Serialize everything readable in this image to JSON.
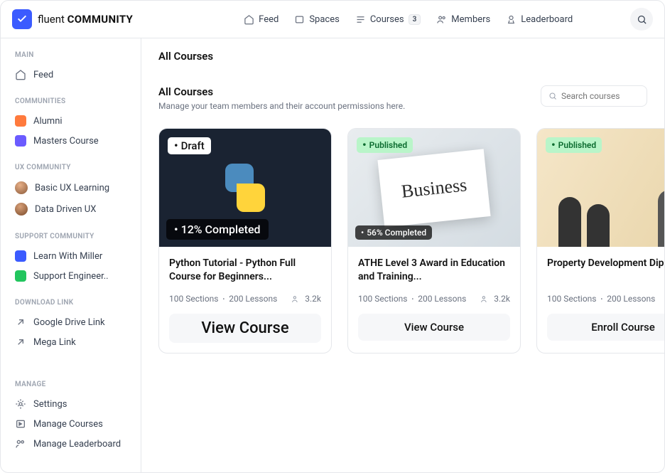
{
  "logo": {
    "text1": "fluent",
    "text2": "COMMUNITY"
  },
  "topnav": {
    "feed": "Feed",
    "spaces": "Spaces",
    "courses": "Courses",
    "courses_badge": "3",
    "members": "Members",
    "leaderboard": "Leaderboard"
  },
  "sidebar": {
    "labels": {
      "main": "MAIN",
      "communities": "COMMUNITIES",
      "ux": "UX COMMUNITY",
      "support": "SUPPORT COMMUNITY",
      "download": "DOWNLOAD LINK",
      "manage": "MANAGE"
    },
    "main": {
      "feed": "Feed"
    },
    "communities": {
      "alumni": "Alumni",
      "masters": "Masters Course"
    },
    "ux": {
      "basic": "Basic UX Learning",
      "data": "Data Driven UX"
    },
    "support": {
      "miller": "Learn With Miller",
      "eng": "Support Engineer.."
    },
    "download": {
      "gdrive": "Google Drive Link",
      "mega": "Mega Link"
    },
    "manage": {
      "settings": "Settings",
      "courses": "Manage Courses",
      "leaderboard": "Manage Leaderboard"
    }
  },
  "page": {
    "breadcrumb": "All Courses",
    "title": "All Courses",
    "subtitle": "Manage your team members and their account permissions here.",
    "search_placeholder": "Search courses"
  },
  "courses": [
    {
      "status": "Draft",
      "status_class": "",
      "progress": "12% Completed",
      "progress_class": "",
      "title": "Python Tutorial - Python Full Course for Beginners...",
      "sections": "100 Sections",
      "lessons": "200 Lessons",
      "members": "3.2k",
      "button": "View Course",
      "button_class": "big",
      "thumb_text": ""
    },
    {
      "status": "Published",
      "status_class": "pub",
      "progress": "56% Completed",
      "progress_class": "sm",
      "title": "ATHE Level 3 Award in Education and Training...",
      "sections": "100 Sections",
      "lessons": "200 Lessons",
      "members": "3.2k",
      "button": "View Course",
      "button_class": "",
      "thumb_text": "Business"
    },
    {
      "status": "Published",
      "status_class": "pub",
      "progress": "",
      "progress_class": "",
      "title": "Property Development Dip",
      "sections": "100 Sections",
      "lessons": "200 Lessons",
      "members": "",
      "button": "Enroll Course",
      "button_class": "",
      "thumb_text": ""
    }
  ],
  "colors": {
    "alumni": "#ff7a3d",
    "masters": "#6b5bff",
    "miller": "#3b5bff",
    "eng": "#22c55e"
  }
}
